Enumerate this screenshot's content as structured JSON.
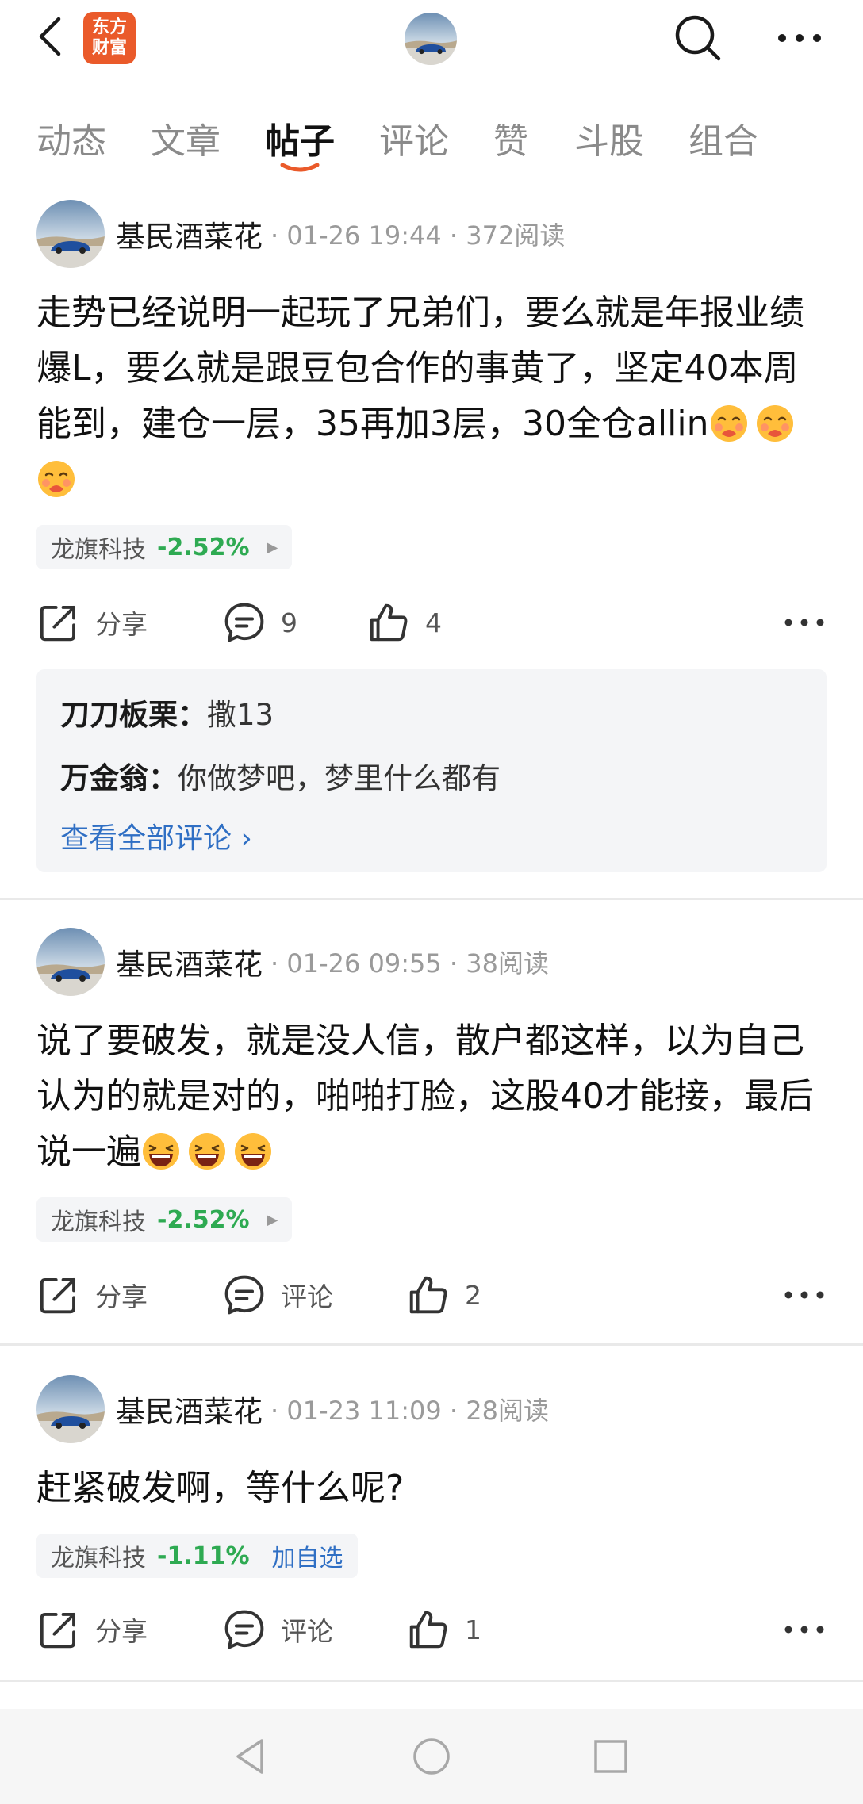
{
  "header": {
    "logo_line1": "东方",
    "logo_line2": "财富",
    "icons": [
      "back-arrow-icon",
      "search-icon",
      "more-icon"
    ]
  },
  "tabs": [
    {
      "label": "动态",
      "active": false
    },
    {
      "label": "文章",
      "active": false
    },
    {
      "label": "帖子",
      "active": true
    },
    {
      "label": "评论",
      "active": false
    },
    {
      "label": "赞",
      "active": false
    },
    {
      "label": "斗股",
      "active": false
    },
    {
      "label": "组合",
      "active": false
    }
  ],
  "posts": [
    {
      "author": "基民酒菜花",
      "meta": "· 01-26 19:44 · 372阅读",
      "body": "走势已经说明一起玩了兄弟们，要么就是年报业绩爆L，要么就是跟豆包合作的事黄了，坚定40本周能到，建仓一层，35再加3层，30全仓allin",
      "emoji": "😘",
      "stock_name": "龙旗科技",
      "stock_change": "-2.52%",
      "share_label": "分享",
      "comment_label": "9",
      "like_count": "4",
      "comments": [
        {
          "user": "刀刀板栗：",
          "text": "撒13"
        },
        {
          "user": "万金翁：",
          "text": "你做梦吧，梦里什么都有"
        }
      ],
      "view_all": "查看全部评论 ›"
    },
    {
      "author": "基民酒菜花",
      "meta": "· 01-26 09:55 · 38阅读",
      "body": "说了要破发，就是没人信，散户都这样，以为自己认为的就是对的，啪啪打脸，这股40才能接，最后说一遍",
      "emoji": "😂",
      "stock_name": "龙旗科技",
      "stock_change": "-2.52%",
      "share_label": "分享",
      "comment_label": "评论",
      "like_count": "2"
    },
    {
      "author": "基民酒菜花",
      "meta": "· 01-23 11:09 · 28阅读",
      "body": "赶紧破发啊，等什么呢?",
      "stock_name": "龙旗科技",
      "stock_change": "-1.11%",
      "stock_add": "加自选",
      "share_label": "分享",
      "comment_label": "评论",
      "like_count": "1"
    }
  ],
  "colors": {
    "accent": "#ea5a2a",
    "down_green": "#2eaa52",
    "link_blue": "#2f6fc4"
  }
}
